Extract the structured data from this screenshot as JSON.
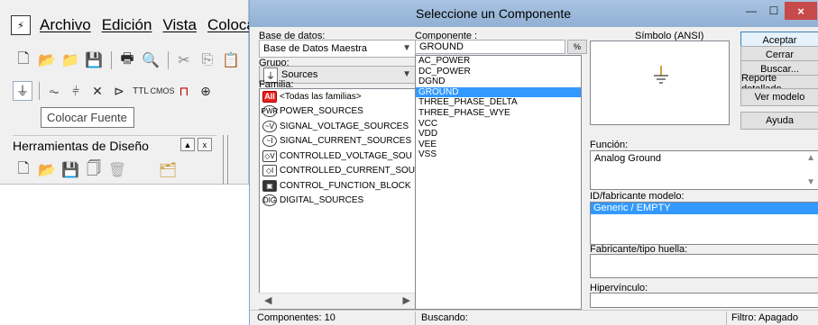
{
  "background_app": {
    "menu": [
      "Archivo",
      "Edición",
      "Vista",
      "Colocar"
    ],
    "toolbar1": [
      "new-file-icon",
      "open-icon",
      "open-folder-icon",
      "save-icon",
      "print-icon",
      "print-preview-icon",
      "cut-icon",
      "copy-icon",
      "paste-icon"
    ],
    "toolbar2_glyphs": [
      "⏚",
      "⏦",
      "⫩",
      "⨯",
      "⊳",
      "⊳",
      "⊳",
      "⊓",
      "⊕"
    ],
    "tooltip": "Colocar Fuente",
    "panel_title": "Herramientas de Diseño",
    "panel_btn_pin": "▲",
    "panel_btn_close": "x"
  },
  "dialog": {
    "title": "Seleccione un Componente",
    "window_buttons": {
      "min": "—",
      "max": "☐",
      "close": "×"
    },
    "db_label": "Base de datos:",
    "db_value": "Base de Datos Maestra",
    "group_label": "Grupo:",
    "group_value": "Sources",
    "family_label": "Familia:",
    "families": [
      {
        "icon": "All",
        "label": "<Todas las familias>"
      },
      {
        "icon": "PWR",
        "label": "POWER_SOURCES"
      },
      {
        "icon": "~V",
        "label": "SIGNAL_VOLTAGE_SOURCES"
      },
      {
        "icon": "~I",
        "label": "SIGNAL_CURRENT_SOURCES"
      },
      {
        "icon": "◇V",
        "label": "CONTROLLED_VOLTAGE_SOU"
      },
      {
        "icon": "◇I",
        "label": "CONTROLLED_CURRENT_SOU"
      },
      {
        "icon": "▣",
        "label": "CONTROL_FUNCTION_BLOCK"
      },
      {
        "icon": "DIG",
        "label": "DIGITAL_SOURCES"
      }
    ],
    "component_label": "Componente :",
    "component_value": "GROUND",
    "filter_btn": "%",
    "components": [
      "AC_POWER",
      "DC_POWER",
      "DGND",
      "GROUND",
      "THREE_PHASE_DELTA",
      "THREE_PHASE_WYE",
      "VCC",
      "VDD",
      "VEE",
      "VSS"
    ],
    "selected_component": "GROUND",
    "symbol_label": "Símbolo (ANSI)",
    "buttons": {
      "accept": "Aceptar",
      "close": "Cerrar",
      "search": "Buscar...",
      "report": "Reporte detallado",
      "model": "Ver modelo",
      "help": "Ayuda"
    },
    "function_label": "Función:",
    "function_value": "Analog Ground",
    "model_label": "ID/fabricante modelo:",
    "model_value": "Generic / EMPTY",
    "footprint_label": "Fabricante/tipo huella:",
    "hyperlink_label": "Hipervínculo:",
    "status": {
      "components": "Componentes: 10",
      "searching": "Buscando:",
      "filter": "Filtro: Apagado"
    },
    "colors": {
      "selection": "#3399ff",
      "titlebar": "#99b4d1",
      "close_btn": "#c74a4a",
      "family_all_icon": "#e8211d"
    }
  }
}
